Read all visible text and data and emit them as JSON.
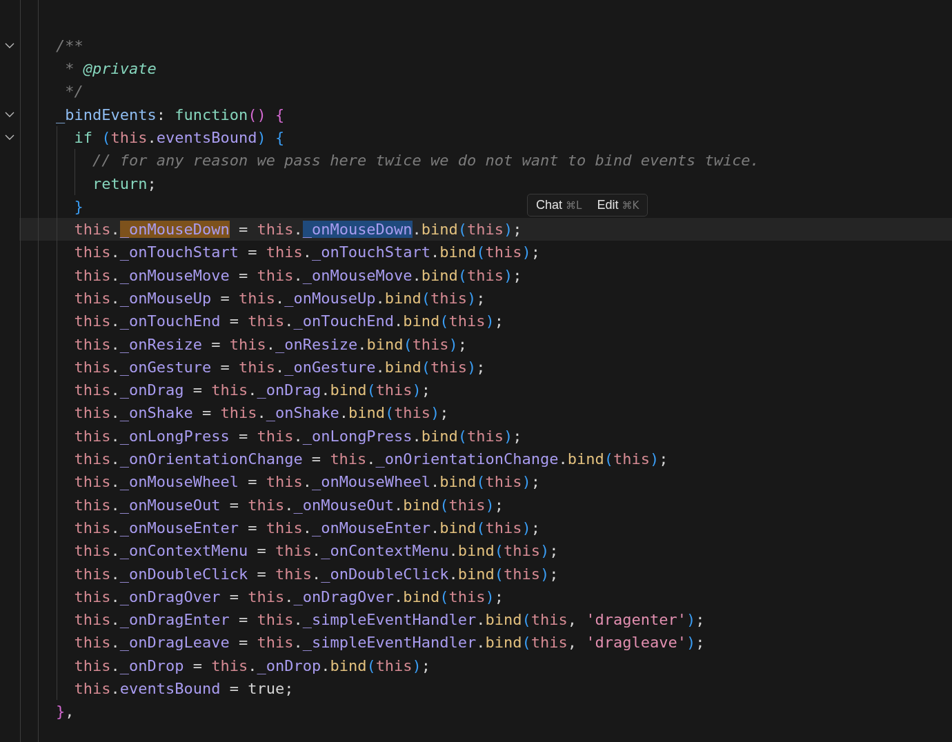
{
  "editor": {
    "lines": [
      {
        "fold_marker": false,
        "current": false
      },
      {
        "fold_marker": false,
        "current": false
      },
      {
        "fold_marker": true,
        "current": false,
        "tokens": [
          {
            "kind": "comment",
            "text": "    /**"
          }
        ]
      },
      {
        "fold_marker": false,
        "current": false,
        "tokens": [
          {
            "kind": "comment",
            "text": "     * "
          },
          {
            "kind": "doctag",
            "text": "@private"
          }
        ]
      },
      {
        "fold_marker": false,
        "current": false,
        "tokens": [
          {
            "kind": "comment",
            "text": "     */"
          }
        ]
      },
      {
        "fold_marker": true,
        "current": false,
        "tokens": [
          {
            "kind": "fn",
            "text": "    _bindEvents"
          },
          {
            "kind": "punct",
            "text": ": "
          },
          {
            "kind": "keyword",
            "text": "function"
          },
          {
            "kind": "brace1",
            "text": "() {"
          }
        ]
      },
      {
        "fold_marker": true,
        "current": false,
        "tokens": [
          {
            "kind": "keyword",
            "text": "      if "
          },
          {
            "kind": "paren",
            "text": "("
          },
          {
            "kind": "this",
            "text": "this"
          },
          {
            "kind": "punct",
            "text": "."
          },
          {
            "kind": "prop",
            "text": "eventsBound"
          },
          {
            "kind": "paren",
            "text": ") {"
          }
        ]
      },
      {
        "fold_marker": false,
        "current": false,
        "tokens": [
          {
            "kind": "comment",
            "text": "        // for any reason we pass here twice we do not want to bind events twice."
          }
        ]
      },
      {
        "fold_marker": false,
        "current": false,
        "tokens": [
          {
            "kind": "keyword",
            "text": "        return"
          },
          {
            "kind": "punct",
            "text": ";"
          }
        ]
      },
      {
        "fold_marker": false,
        "current": false,
        "tokens": [
          {
            "kind": "paren",
            "text": "      }"
          }
        ]
      },
      {
        "fold_marker": false,
        "current": true,
        "tokens": [
          {
            "kind": "this",
            "text": "      this"
          },
          {
            "kind": "punct",
            "text": "."
          },
          {
            "kind": "prop",
            "text": "_onMouseDown",
            "match": true
          },
          {
            "kind": "punct",
            "text": " = "
          },
          {
            "kind": "this",
            "text": "this"
          },
          {
            "kind": "punct",
            "text": "."
          },
          {
            "kind": "prop",
            "text": "_onMouseDown",
            "selection": true
          },
          {
            "kind": "punct",
            "text": "."
          },
          {
            "kind": "method",
            "text": "bind"
          },
          {
            "kind": "paren",
            "text": "("
          },
          {
            "kind": "this",
            "text": "this"
          },
          {
            "kind": "paren",
            "text": ")"
          },
          {
            "kind": "punct",
            "text": ";"
          }
        ]
      },
      {
        "fold_marker": false,
        "current": false,
        "tokens": [
          {
            "kind": "this",
            "text": "      this"
          },
          {
            "kind": "punct",
            "text": "."
          },
          {
            "kind": "prop",
            "text": "_onTouchStart"
          },
          {
            "kind": "punct",
            "text": " = "
          },
          {
            "kind": "this",
            "text": "this"
          },
          {
            "kind": "punct",
            "text": "."
          },
          {
            "kind": "prop",
            "text": "_onTouchStart"
          },
          {
            "kind": "punct",
            "text": "."
          },
          {
            "kind": "method",
            "text": "bind"
          },
          {
            "kind": "paren",
            "text": "("
          },
          {
            "kind": "this",
            "text": "this"
          },
          {
            "kind": "paren",
            "text": ")"
          },
          {
            "kind": "punct",
            "text": ";"
          }
        ]
      },
      {
        "fold_marker": false,
        "current": false,
        "tokens": [
          {
            "kind": "this",
            "text": "      this"
          },
          {
            "kind": "punct",
            "text": "."
          },
          {
            "kind": "prop",
            "text": "_onMouseMove"
          },
          {
            "kind": "punct",
            "text": " = "
          },
          {
            "kind": "this",
            "text": "this"
          },
          {
            "kind": "punct",
            "text": "."
          },
          {
            "kind": "prop",
            "text": "_onMouseMove"
          },
          {
            "kind": "punct",
            "text": "."
          },
          {
            "kind": "method",
            "text": "bind"
          },
          {
            "kind": "paren",
            "text": "("
          },
          {
            "kind": "this",
            "text": "this"
          },
          {
            "kind": "paren",
            "text": ")"
          },
          {
            "kind": "punct",
            "text": ";"
          }
        ]
      },
      {
        "fold_marker": false,
        "current": false,
        "tokens": [
          {
            "kind": "this",
            "text": "      this"
          },
          {
            "kind": "punct",
            "text": "."
          },
          {
            "kind": "prop",
            "text": "_onMouseUp"
          },
          {
            "kind": "punct",
            "text": " = "
          },
          {
            "kind": "this",
            "text": "this"
          },
          {
            "kind": "punct",
            "text": "."
          },
          {
            "kind": "prop",
            "text": "_onMouseUp"
          },
          {
            "kind": "punct",
            "text": "."
          },
          {
            "kind": "method",
            "text": "bind"
          },
          {
            "kind": "paren",
            "text": "("
          },
          {
            "kind": "this",
            "text": "this"
          },
          {
            "kind": "paren",
            "text": ")"
          },
          {
            "kind": "punct",
            "text": ";"
          }
        ]
      },
      {
        "fold_marker": false,
        "current": false,
        "tokens": [
          {
            "kind": "this",
            "text": "      this"
          },
          {
            "kind": "punct",
            "text": "."
          },
          {
            "kind": "prop",
            "text": "_onTouchEnd"
          },
          {
            "kind": "punct",
            "text": " = "
          },
          {
            "kind": "this",
            "text": "this"
          },
          {
            "kind": "punct",
            "text": "."
          },
          {
            "kind": "prop",
            "text": "_onTouchEnd"
          },
          {
            "kind": "punct",
            "text": "."
          },
          {
            "kind": "method",
            "text": "bind"
          },
          {
            "kind": "paren",
            "text": "("
          },
          {
            "kind": "this",
            "text": "this"
          },
          {
            "kind": "paren",
            "text": ")"
          },
          {
            "kind": "punct",
            "text": ";"
          }
        ]
      },
      {
        "fold_marker": false,
        "current": false,
        "tokens": [
          {
            "kind": "this",
            "text": "      this"
          },
          {
            "kind": "punct",
            "text": "."
          },
          {
            "kind": "prop",
            "text": "_onResize"
          },
          {
            "kind": "punct",
            "text": " = "
          },
          {
            "kind": "this",
            "text": "this"
          },
          {
            "kind": "punct",
            "text": "."
          },
          {
            "kind": "prop",
            "text": "_onResize"
          },
          {
            "kind": "punct",
            "text": "."
          },
          {
            "kind": "method",
            "text": "bind"
          },
          {
            "kind": "paren",
            "text": "("
          },
          {
            "kind": "this",
            "text": "this"
          },
          {
            "kind": "paren",
            "text": ")"
          },
          {
            "kind": "punct",
            "text": ";"
          }
        ]
      },
      {
        "fold_marker": false,
        "current": false,
        "tokens": [
          {
            "kind": "this",
            "text": "      this"
          },
          {
            "kind": "punct",
            "text": "."
          },
          {
            "kind": "prop",
            "text": "_onGesture"
          },
          {
            "kind": "punct",
            "text": " = "
          },
          {
            "kind": "this",
            "text": "this"
          },
          {
            "kind": "punct",
            "text": "."
          },
          {
            "kind": "prop",
            "text": "_onGesture"
          },
          {
            "kind": "punct",
            "text": "."
          },
          {
            "kind": "method",
            "text": "bind"
          },
          {
            "kind": "paren",
            "text": "("
          },
          {
            "kind": "this",
            "text": "this"
          },
          {
            "kind": "paren",
            "text": ")"
          },
          {
            "kind": "punct",
            "text": ";"
          }
        ]
      },
      {
        "fold_marker": false,
        "current": false,
        "tokens": [
          {
            "kind": "this",
            "text": "      this"
          },
          {
            "kind": "punct",
            "text": "."
          },
          {
            "kind": "prop",
            "text": "_onDrag"
          },
          {
            "kind": "punct",
            "text": " = "
          },
          {
            "kind": "this",
            "text": "this"
          },
          {
            "kind": "punct",
            "text": "."
          },
          {
            "kind": "prop",
            "text": "_onDrag"
          },
          {
            "kind": "punct",
            "text": "."
          },
          {
            "kind": "method",
            "text": "bind"
          },
          {
            "kind": "paren",
            "text": "("
          },
          {
            "kind": "this",
            "text": "this"
          },
          {
            "kind": "paren",
            "text": ")"
          },
          {
            "kind": "punct",
            "text": ";"
          }
        ]
      },
      {
        "fold_marker": false,
        "current": false,
        "tokens": [
          {
            "kind": "this",
            "text": "      this"
          },
          {
            "kind": "punct",
            "text": "."
          },
          {
            "kind": "prop",
            "text": "_onShake"
          },
          {
            "kind": "punct",
            "text": " = "
          },
          {
            "kind": "this",
            "text": "this"
          },
          {
            "kind": "punct",
            "text": "."
          },
          {
            "kind": "prop",
            "text": "_onShake"
          },
          {
            "kind": "punct",
            "text": "."
          },
          {
            "kind": "method",
            "text": "bind"
          },
          {
            "kind": "paren",
            "text": "("
          },
          {
            "kind": "this",
            "text": "this"
          },
          {
            "kind": "paren",
            "text": ")"
          },
          {
            "kind": "punct",
            "text": ";"
          }
        ]
      },
      {
        "fold_marker": false,
        "current": false,
        "tokens": [
          {
            "kind": "this",
            "text": "      this"
          },
          {
            "kind": "punct",
            "text": "."
          },
          {
            "kind": "prop",
            "text": "_onLongPress"
          },
          {
            "kind": "punct",
            "text": " = "
          },
          {
            "kind": "this",
            "text": "this"
          },
          {
            "kind": "punct",
            "text": "."
          },
          {
            "kind": "prop",
            "text": "_onLongPress"
          },
          {
            "kind": "punct",
            "text": "."
          },
          {
            "kind": "method",
            "text": "bind"
          },
          {
            "kind": "paren",
            "text": "("
          },
          {
            "kind": "this",
            "text": "this"
          },
          {
            "kind": "paren",
            "text": ")"
          },
          {
            "kind": "punct",
            "text": ";"
          }
        ]
      },
      {
        "fold_marker": false,
        "current": false,
        "tokens": [
          {
            "kind": "this",
            "text": "      this"
          },
          {
            "kind": "punct",
            "text": "."
          },
          {
            "kind": "prop",
            "text": "_onOrientationChange"
          },
          {
            "kind": "punct",
            "text": " = "
          },
          {
            "kind": "this",
            "text": "this"
          },
          {
            "kind": "punct",
            "text": "."
          },
          {
            "kind": "prop",
            "text": "_onOrientationChange"
          },
          {
            "kind": "punct",
            "text": "."
          },
          {
            "kind": "method",
            "text": "bind"
          },
          {
            "kind": "paren",
            "text": "("
          },
          {
            "kind": "this",
            "text": "this"
          },
          {
            "kind": "paren",
            "text": ")"
          },
          {
            "kind": "punct",
            "text": ";"
          }
        ]
      },
      {
        "fold_marker": false,
        "current": false,
        "tokens": [
          {
            "kind": "this",
            "text": "      this"
          },
          {
            "kind": "punct",
            "text": "."
          },
          {
            "kind": "prop",
            "text": "_onMouseWheel"
          },
          {
            "kind": "punct",
            "text": " = "
          },
          {
            "kind": "this",
            "text": "this"
          },
          {
            "kind": "punct",
            "text": "."
          },
          {
            "kind": "prop",
            "text": "_onMouseWheel"
          },
          {
            "kind": "punct",
            "text": "."
          },
          {
            "kind": "method",
            "text": "bind"
          },
          {
            "kind": "paren",
            "text": "("
          },
          {
            "kind": "this",
            "text": "this"
          },
          {
            "kind": "paren",
            "text": ")"
          },
          {
            "kind": "punct",
            "text": ";"
          }
        ]
      },
      {
        "fold_marker": false,
        "current": false,
        "tokens": [
          {
            "kind": "this",
            "text": "      this"
          },
          {
            "kind": "punct",
            "text": "."
          },
          {
            "kind": "prop",
            "text": "_onMouseOut"
          },
          {
            "kind": "punct",
            "text": " = "
          },
          {
            "kind": "this",
            "text": "this"
          },
          {
            "kind": "punct",
            "text": "."
          },
          {
            "kind": "prop",
            "text": "_onMouseOut"
          },
          {
            "kind": "punct",
            "text": "."
          },
          {
            "kind": "method",
            "text": "bind"
          },
          {
            "kind": "paren",
            "text": "("
          },
          {
            "kind": "this",
            "text": "this"
          },
          {
            "kind": "paren",
            "text": ")"
          },
          {
            "kind": "punct",
            "text": ";"
          }
        ]
      },
      {
        "fold_marker": false,
        "current": false,
        "tokens": [
          {
            "kind": "this",
            "text": "      this"
          },
          {
            "kind": "punct",
            "text": "."
          },
          {
            "kind": "prop",
            "text": "_onMouseEnter"
          },
          {
            "kind": "punct",
            "text": " = "
          },
          {
            "kind": "this",
            "text": "this"
          },
          {
            "kind": "punct",
            "text": "."
          },
          {
            "kind": "prop",
            "text": "_onMouseEnter"
          },
          {
            "kind": "punct",
            "text": "."
          },
          {
            "kind": "method",
            "text": "bind"
          },
          {
            "kind": "paren",
            "text": "("
          },
          {
            "kind": "this",
            "text": "this"
          },
          {
            "kind": "paren",
            "text": ")"
          },
          {
            "kind": "punct",
            "text": ";"
          }
        ]
      },
      {
        "fold_marker": false,
        "current": false,
        "tokens": [
          {
            "kind": "this",
            "text": "      this"
          },
          {
            "kind": "punct",
            "text": "."
          },
          {
            "kind": "prop",
            "text": "_onContextMenu"
          },
          {
            "kind": "punct",
            "text": " = "
          },
          {
            "kind": "this",
            "text": "this"
          },
          {
            "kind": "punct",
            "text": "."
          },
          {
            "kind": "prop",
            "text": "_onContextMenu"
          },
          {
            "kind": "punct",
            "text": "."
          },
          {
            "kind": "method",
            "text": "bind"
          },
          {
            "kind": "paren",
            "text": "("
          },
          {
            "kind": "this",
            "text": "this"
          },
          {
            "kind": "paren",
            "text": ")"
          },
          {
            "kind": "punct",
            "text": ";"
          }
        ]
      },
      {
        "fold_marker": false,
        "current": false,
        "tokens": [
          {
            "kind": "this",
            "text": "      this"
          },
          {
            "kind": "punct",
            "text": "."
          },
          {
            "kind": "prop",
            "text": "_onDoubleClick"
          },
          {
            "kind": "punct",
            "text": " = "
          },
          {
            "kind": "this",
            "text": "this"
          },
          {
            "kind": "punct",
            "text": "."
          },
          {
            "kind": "prop",
            "text": "_onDoubleClick"
          },
          {
            "kind": "punct",
            "text": "."
          },
          {
            "kind": "method",
            "text": "bind"
          },
          {
            "kind": "paren",
            "text": "("
          },
          {
            "kind": "this",
            "text": "this"
          },
          {
            "kind": "paren",
            "text": ")"
          },
          {
            "kind": "punct",
            "text": ";"
          }
        ]
      },
      {
        "fold_marker": false,
        "current": false,
        "tokens": [
          {
            "kind": "this",
            "text": "      this"
          },
          {
            "kind": "punct",
            "text": "."
          },
          {
            "kind": "prop",
            "text": "_onDragOver"
          },
          {
            "kind": "punct",
            "text": " = "
          },
          {
            "kind": "this",
            "text": "this"
          },
          {
            "kind": "punct",
            "text": "."
          },
          {
            "kind": "prop",
            "text": "_onDragOver"
          },
          {
            "kind": "punct",
            "text": "."
          },
          {
            "kind": "method",
            "text": "bind"
          },
          {
            "kind": "paren",
            "text": "("
          },
          {
            "kind": "this",
            "text": "this"
          },
          {
            "kind": "paren",
            "text": ")"
          },
          {
            "kind": "punct",
            "text": ";"
          }
        ]
      },
      {
        "fold_marker": false,
        "current": false,
        "tokens": [
          {
            "kind": "this",
            "text": "      this"
          },
          {
            "kind": "punct",
            "text": "."
          },
          {
            "kind": "prop",
            "text": "_onDragEnter"
          },
          {
            "kind": "punct",
            "text": " = "
          },
          {
            "kind": "this",
            "text": "this"
          },
          {
            "kind": "punct",
            "text": "."
          },
          {
            "kind": "prop",
            "text": "_simpleEventHandler"
          },
          {
            "kind": "punct",
            "text": "."
          },
          {
            "kind": "method",
            "text": "bind"
          },
          {
            "kind": "paren",
            "text": "("
          },
          {
            "kind": "this",
            "text": "this"
          },
          {
            "kind": "punct",
            "text": ", "
          },
          {
            "kind": "string",
            "text": "'dragenter'"
          },
          {
            "kind": "paren",
            "text": ")"
          },
          {
            "kind": "punct",
            "text": ";"
          }
        ]
      },
      {
        "fold_marker": false,
        "current": false,
        "tokens": [
          {
            "kind": "this",
            "text": "      this"
          },
          {
            "kind": "punct",
            "text": "."
          },
          {
            "kind": "prop",
            "text": "_onDragLeave"
          },
          {
            "kind": "punct",
            "text": " = "
          },
          {
            "kind": "this",
            "text": "this"
          },
          {
            "kind": "punct",
            "text": "."
          },
          {
            "kind": "prop",
            "text": "_simpleEventHandler"
          },
          {
            "kind": "punct",
            "text": "."
          },
          {
            "kind": "method",
            "text": "bind"
          },
          {
            "kind": "paren",
            "text": "("
          },
          {
            "kind": "this",
            "text": "this"
          },
          {
            "kind": "punct",
            "text": ", "
          },
          {
            "kind": "string",
            "text": "'dragleave'"
          },
          {
            "kind": "paren",
            "text": ")"
          },
          {
            "kind": "punct",
            "text": ";"
          }
        ]
      },
      {
        "fold_marker": false,
        "current": false,
        "tokens": [
          {
            "kind": "this",
            "text": "      this"
          },
          {
            "kind": "punct",
            "text": "."
          },
          {
            "kind": "prop",
            "text": "_onDrop"
          },
          {
            "kind": "punct",
            "text": " = "
          },
          {
            "kind": "this",
            "text": "this"
          },
          {
            "kind": "punct",
            "text": "."
          },
          {
            "kind": "prop",
            "text": "_onDrop"
          },
          {
            "kind": "punct",
            "text": "."
          },
          {
            "kind": "method",
            "text": "bind"
          },
          {
            "kind": "paren",
            "text": "("
          },
          {
            "kind": "this",
            "text": "this"
          },
          {
            "kind": "paren",
            "text": ")"
          },
          {
            "kind": "punct",
            "text": ";"
          }
        ]
      },
      {
        "fold_marker": false,
        "current": false,
        "tokens": [
          {
            "kind": "this",
            "text": "      this"
          },
          {
            "kind": "punct",
            "text": "."
          },
          {
            "kind": "prop",
            "text": "eventsBound"
          },
          {
            "kind": "punct",
            "text": " = true;"
          }
        ]
      },
      {
        "fold_marker": false,
        "current": false,
        "tokens": [
          {
            "kind": "brace1",
            "text": "    }"
          },
          {
            "kind": "punct",
            "text": ","
          }
        ]
      },
      {
        "fold_marker": false,
        "current": false
      }
    ]
  },
  "inline_hint": [
    {
      "label": "Chat",
      "shortcut": "⌘L"
    },
    {
      "label": "Edit",
      "shortcut": "⌘K"
    }
  ]
}
